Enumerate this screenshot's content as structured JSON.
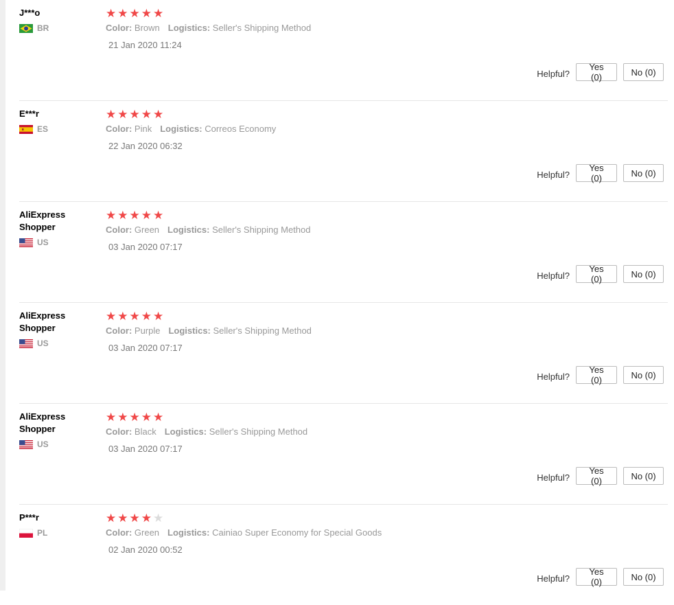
{
  "helpful_label": "Helpful?",
  "reviews": [
    {
      "user": "J***o",
      "country": "BR",
      "flag": "brazil-flag-icon",
      "rating": 5,
      "color_label": "Color:",
      "color": "Brown",
      "logistics_label": "Logistics:",
      "logistics": "Seller's Shipping Method",
      "date": "21 Jan 2020 11:24",
      "yes": "Yes (0)",
      "no": "No (0)"
    },
    {
      "user": "E***r",
      "country": "ES",
      "flag": "spain-flag-icon",
      "rating": 5,
      "color_label": "Color:",
      "color": "Pink",
      "logistics_label": "Logistics:",
      "logistics": "Correos Economy",
      "date": "22 Jan 2020 06:32",
      "yes": "Yes (0)",
      "no": "No (0)"
    },
    {
      "user": "AliExpress\nShopper",
      "country": "US",
      "flag": "us-flag-icon",
      "rating": 5,
      "color_label": "Color:",
      "color": "Green",
      "logistics_label": "Logistics:",
      "logistics": "Seller's Shipping Method",
      "date": "03 Jan 2020 07:17",
      "yes": "Yes (0)",
      "no": "No (0)"
    },
    {
      "user": "AliExpress\nShopper",
      "country": "US",
      "flag": "us-flag-icon",
      "rating": 5,
      "color_label": "Color:",
      "color": "Purple",
      "logistics_label": "Logistics:",
      "logistics": "Seller's Shipping Method",
      "date": "03 Jan 2020 07:17",
      "yes": "Yes (0)",
      "no": "No (0)"
    },
    {
      "user": "AliExpress\nShopper",
      "country": "US",
      "flag": "us-flag-icon",
      "rating": 5,
      "color_label": "Color:",
      "color": "Black",
      "logistics_label": "Logistics:",
      "logistics": "Seller's Shipping Method",
      "date": "03 Jan 2020 07:17",
      "yes": "Yes (0)",
      "no": "No (0)"
    },
    {
      "user": "P***r",
      "country": "PL",
      "flag": "poland-flag-icon",
      "rating": 4,
      "color_label": "Color:",
      "color": "Green",
      "logistics_label": "Logistics:",
      "logistics": "Cainiao Super Economy for Special Goods",
      "date": "02 Jan 2020 00:52",
      "yes": "Yes (0)",
      "no": "No (0)"
    }
  ],
  "colors": {
    "star": "#f04848",
    "star_empty": "#dcdcdc"
  }
}
